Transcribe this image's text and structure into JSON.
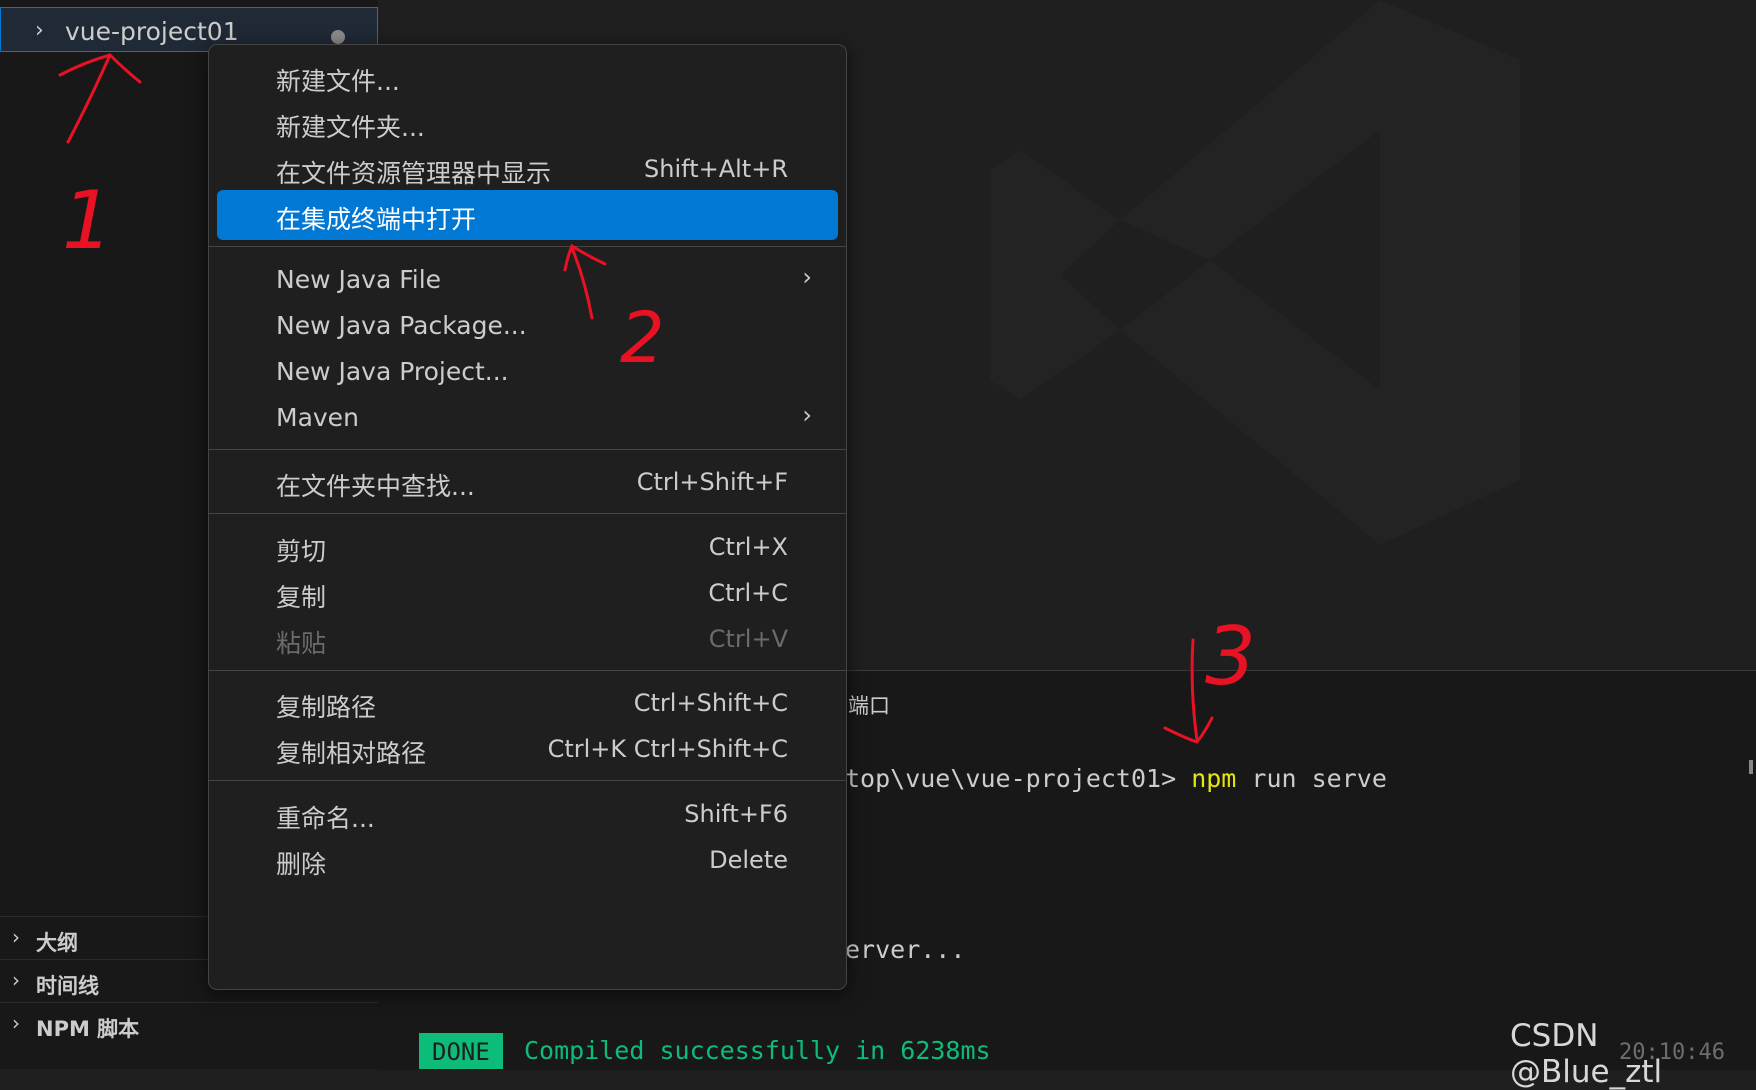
{
  "explorer": {
    "folder_label": "vue-project01",
    "folder_chevron": "chevron-right-icon",
    "sections": [
      {
        "label": "大纲"
      },
      {
        "label": "时间线"
      },
      {
        "label": "NPM 脚本"
      }
    ]
  },
  "context_menu": {
    "items": [
      {
        "label": "新建文件...",
        "shortcut": ""
      },
      {
        "label": "新建文件夹...",
        "shortcut": ""
      },
      {
        "label": "在文件资源管理器中显示",
        "shortcut": "Shift+Alt+R"
      },
      {
        "label": "在集成终端中打开",
        "shortcut": "",
        "state": "highlighted"
      },
      {
        "label": "New Java File",
        "submenu": true
      },
      {
        "label": "New Java Package...",
        "shortcut": ""
      },
      {
        "label": "New Java Project...",
        "shortcut": ""
      },
      {
        "label": "Maven",
        "submenu": true
      },
      {
        "label": "在文件夹中查找...",
        "shortcut": "Ctrl+Shift+F"
      },
      {
        "label": "剪切",
        "shortcut": "Ctrl+X"
      },
      {
        "label": "复制",
        "shortcut": "Ctrl+C"
      },
      {
        "label": "粘贴",
        "shortcut": "Ctrl+V",
        "state": "disabled"
      },
      {
        "label": "复制路径",
        "shortcut": "Ctrl+Shift+C"
      },
      {
        "label": "复制相对路径",
        "shortcut": "Ctrl+K Ctrl+Shift+C"
      },
      {
        "label": "重命名...",
        "shortcut": "Shift+F6"
      },
      {
        "label": "删除",
        "shortcut": "Delete"
      }
    ],
    "highlight_color": "#0078d4"
  },
  "panel": {
    "tab_label": "端口",
    "terminal": {
      "prompt_path": "top\\vue\\vue-project01>",
      "command": "npm",
      "command_args": "run serve",
      "output_line": "erver...",
      "done_badge": "DONE",
      "compiled_message": "Compiled successfully in 6238ms",
      "timestamp": "20:10:46"
    }
  },
  "annotations": {
    "numbers": [
      "1",
      "2",
      "3"
    ],
    "color": "#e81224"
  },
  "watermark_text": "CSDN @Blue_ztl",
  "icons": {
    "chevron": "chevron-right-icon",
    "dirty_dot": "modified-dot-icon",
    "submenu": "chevron-right-icon",
    "editor_logo": "vscode-logo-icon"
  }
}
